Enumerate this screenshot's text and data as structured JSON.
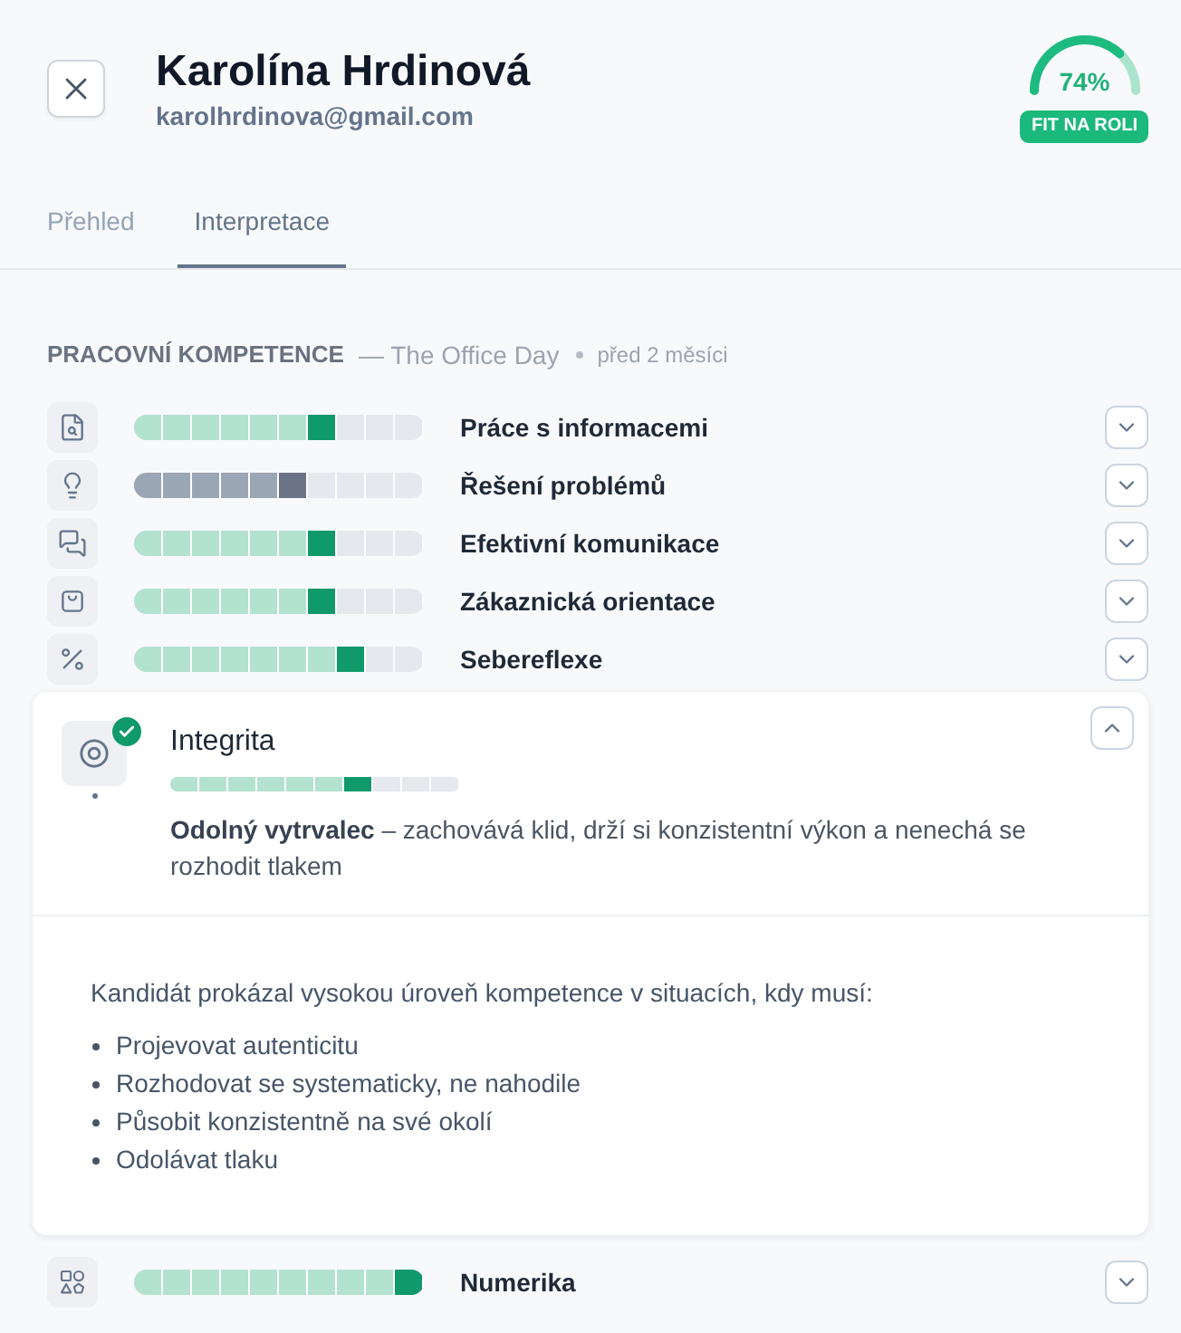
{
  "candidate": {
    "name": "Karolína Hrdinová",
    "email": "karolhrdinova@gmail.com"
  },
  "fit": {
    "value": "74%",
    "level": 0.74,
    "label": "FIT NA ROLI"
  },
  "tabs": [
    {
      "label": "Přehled",
      "selected": false
    },
    {
      "label": "Interpretace",
      "selected": true
    }
  ],
  "section": {
    "title": "PRACOVNÍ KOMPETENCE",
    "source": "— The Office Day",
    "time": "před 2 měsíci"
  },
  "competencies": [
    {
      "name": "Práce s informacemi",
      "level": 0.7,
      "muted": false,
      "verified": false,
      "expanded": false
    },
    {
      "name": "Řešení problémů",
      "level": 0.6,
      "muted": true,
      "verified": false,
      "expanded": false
    },
    {
      "name": "Efektivní komunikace",
      "level": 0.7,
      "muted": false,
      "verified": false,
      "expanded": false
    },
    {
      "name": "Zákaznická orientace",
      "level": 0.7,
      "muted": false,
      "verified": false,
      "expanded": false
    },
    {
      "name": "Sebereflexe",
      "level": 0.8,
      "muted": false,
      "verified": false,
      "expanded": false
    },
    {
      "name": "Integrita",
      "level": 0.7,
      "muted": false,
      "verified": true,
      "expanded": true,
      "summary": "**Odolný vytrvalec** – zachovává klid, drží si konzistentní výkon a nenechá se rozhodit tlakem",
      "details": {
        "intro": "Kandidát prokázal vysokou úroveň kompetence v situacích, kdy musí:",
        "points": [
          "Projevovat autenticitu",
          "Rozhodovat se systematicky, ne nahodile",
          "Působit konzistentně na své okolí",
          "Odolávat tlaku"
        ]
      }
    },
    {
      "name": "Numerika",
      "level": 1.0,
      "muted": false,
      "verified": false,
      "expanded": false
    }
  ]
}
